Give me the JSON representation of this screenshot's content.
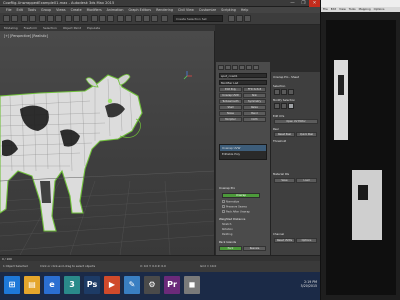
{
  "window": {
    "title": "CowRig-UnwrappedExample01.max - Autodesk 3ds Max 2015",
    "controls": [
      "—",
      "❐",
      "✕"
    ]
  },
  "menu": [
    "File",
    "Edit",
    "Tools",
    "Group",
    "Views",
    "Create",
    "Modifiers",
    "Animation",
    "Graph Editors",
    "Rendering",
    "Civil View",
    "Customize",
    "Scripting",
    "Help"
  ],
  "toolbar": {
    "selection_set": "Create Selection Set"
  },
  "ribbon": [
    "Modeling",
    "Freeform",
    "Selection",
    "Object Paint",
    "Populate"
  ],
  "viewport": {
    "label": "[+] [Perspective] [Realistic]"
  },
  "command_panel": {
    "object_name": "spot_cow01",
    "modifier_list": "Modifier List",
    "modifier_buttons": [
      "Edit Poly",
      "FFD 3x3x3",
      "Unwrap UVW",
      "Skin",
      "Turbosmooth",
      "Symmetry",
      "Shell",
      "Relax",
      "Noise",
      "Bend",
      "Morpher",
      "Cloth"
    ],
    "stack": [
      "Unwrap UVW",
      "Editable Poly"
    ],
    "rollouts": {
      "unwrap_title": "Unwrap Pro",
      "unwrap_button": "Unwrap",
      "options": [
        "Normalize",
        "Preserve Seams",
        "Pack After Unwrap"
      ],
      "weighted_title": "Weighted Distance",
      "fields": [
        "Stretch",
        "Rotation",
        "Padding"
      ],
      "pack_title": "Pack Islands",
      "pack_buttons": [
        "Pack",
        "Rescale"
      ]
    }
  },
  "uv_panel": {
    "title": "Unwrap Pro - Sheet",
    "sections": [
      "Selection",
      "Modify Selection",
      "Edit UVs",
      "Peel",
      "Material IDs",
      "Channel"
    ],
    "buttons": [
      "Open UV Editor",
      "Reset Peel",
      "Quick Peel",
      "Threshold",
      "Save",
      "Load",
      "Reset UVWs",
      "Options"
    ]
  },
  "right_app": {
    "menu": [
      "File",
      "Edit",
      "View",
      "Tools",
      "Mapping",
      "Options"
    ]
  },
  "timeline": {
    "frame": "0 / 100"
  },
  "status": {
    "selected": "1 Object Selected",
    "prompt": "Click or click-and-drag to select objects",
    "coords": "X: 0.0  Y: 0.0  Z: 0.0",
    "grid": "Grid = 10.0"
  },
  "taskbar": {
    "apps": [
      "Start",
      "File Explorer",
      "Browser",
      "3ds Max",
      "Photoshop",
      "Media",
      "Notepad",
      "Settings",
      "Premiere",
      "Misc"
    ],
    "clock_time": "2:19 PM",
    "clock_date": "5/20/2015"
  }
}
